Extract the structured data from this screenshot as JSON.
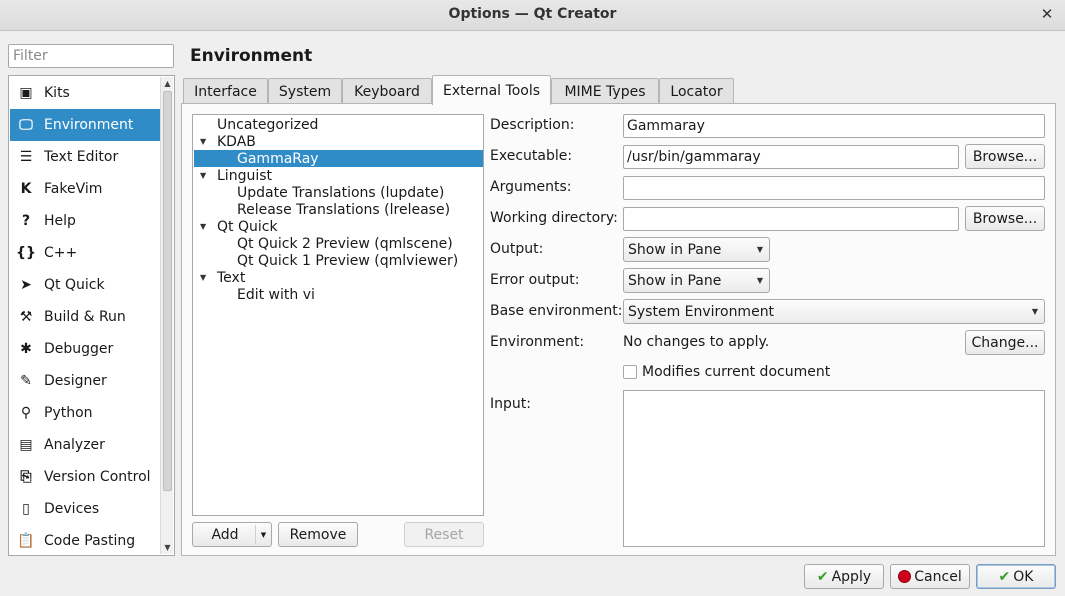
{
  "window": {
    "title": "Options — Qt Creator",
    "close_glyph": "✕"
  },
  "filter": {
    "placeholder": "Filter",
    "value": ""
  },
  "categories": [
    {
      "label": "Kits",
      "icon": "kits-icon",
      "glyph": "▣"
    },
    {
      "label": "Environment",
      "icon": "monitor-icon",
      "glyph": "🖵",
      "selected": true
    },
    {
      "label": "Text Editor",
      "icon": "text-editor-icon",
      "glyph": "☰"
    },
    {
      "label": "FakeVim",
      "icon": "fakevim-icon",
      "glyph": "K"
    },
    {
      "label": "Help",
      "icon": "help-icon",
      "glyph": "?"
    },
    {
      "label": "C++",
      "icon": "braces-icon",
      "glyph": "{}"
    },
    {
      "label": "Qt Quick",
      "icon": "qt-quick-icon",
      "glyph": "➤"
    },
    {
      "label": "Build & Run",
      "icon": "hammer-icon",
      "glyph": "⚒"
    },
    {
      "label": "Debugger",
      "icon": "bug-icon",
      "glyph": "✱"
    },
    {
      "label": "Designer",
      "icon": "pencil-icon",
      "glyph": "✎"
    },
    {
      "label": "Python",
      "icon": "python-icon",
      "glyph": "⚲"
    },
    {
      "label": "Analyzer",
      "icon": "analyzer-icon",
      "glyph": "▤"
    },
    {
      "label": "Version Control",
      "icon": "version-control-icon",
      "glyph": "⎘"
    },
    {
      "label": "Devices",
      "icon": "devices-icon",
      "glyph": "▯"
    },
    {
      "label": "Code Pasting",
      "icon": "clipboard-icon",
      "glyph": "📋"
    }
  ],
  "page_title": "Environment",
  "tabs": [
    {
      "label": "Interface"
    },
    {
      "label": "System"
    },
    {
      "label": "Keyboard"
    },
    {
      "label": "External Tools",
      "active": true
    },
    {
      "label": "MIME Types"
    },
    {
      "label": "Locator"
    }
  ],
  "tool_tree": [
    {
      "label": "Uncategorized",
      "level": 0,
      "expanded": false
    },
    {
      "label": "KDAB",
      "level": 0,
      "expanded": true
    },
    {
      "label": "GammaRay",
      "level": 1,
      "selected": true
    },
    {
      "label": "Linguist",
      "level": 0,
      "expanded": true
    },
    {
      "label": "Update Translations (lupdate)",
      "level": 1
    },
    {
      "label": "Release Translations (lrelease)",
      "level": 1
    },
    {
      "label": "Qt Quick",
      "level": 0,
      "expanded": true
    },
    {
      "label": "Qt Quick 2 Preview (qmlscene)",
      "level": 1
    },
    {
      "label": "Qt Quick 1 Preview (qmlviewer)",
      "level": 1
    },
    {
      "label": "Text",
      "level": 0,
      "expanded": true
    },
    {
      "label": "Edit with vi",
      "level": 1
    }
  ],
  "tree_buttons": {
    "add": "Add",
    "remove": "Remove",
    "reset": "Reset"
  },
  "form": {
    "description_label": "Description:",
    "description_value": "Gammaray",
    "executable_label": "Executable:",
    "executable_value": "/usr/bin/gammaray",
    "arguments_label": "Arguments:",
    "arguments_value": "",
    "working_dir_label": "Working directory:",
    "working_dir_value": "",
    "browse_label": "Browse...",
    "output_label": "Output:",
    "output_value": "Show in Pane",
    "error_output_label": "Error output:",
    "error_output_value": "Show in Pane",
    "base_env_label": "Base environment:",
    "base_env_value": "System Environment",
    "environment_label": "Environment:",
    "environment_value": "No changes to apply.",
    "change_label": "Change...",
    "modifies_label": "Modifies current document",
    "modifies_checked": false,
    "input_label": "Input:",
    "input_value": ""
  },
  "dialog_buttons": {
    "apply": "Apply",
    "cancel": "Cancel",
    "ok": "OK"
  },
  "colors": {
    "selection": "#308cc6",
    "apply_check": "#3c9a2e",
    "cancel_dot": "#d0021b"
  }
}
